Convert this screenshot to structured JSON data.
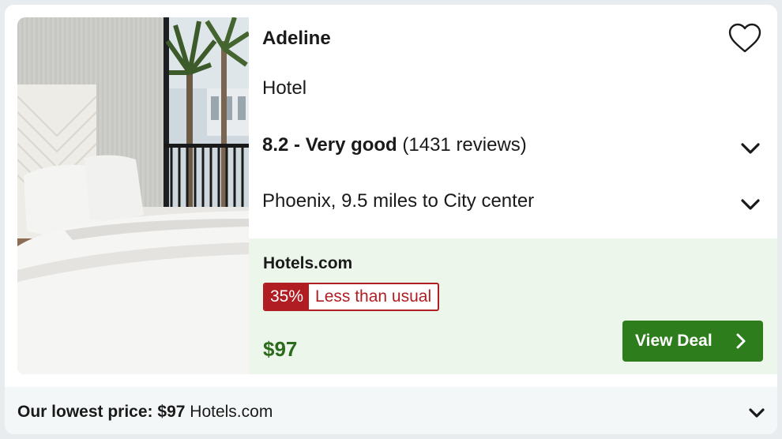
{
  "hotel": {
    "name": "Adeline",
    "type": "Hotel",
    "rating_score": "8.2 - Very good",
    "rating_reviews": "(1431 reviews)",
    "location": "Phoenix, 9.5 miles to City center"
  },
  "deal": {
    "provider": "Hotels.com",
    "discount_percent": "35%",
    "discount_text": "Less than usual",
    "price": "$97",
    "button_label": "View Deal"
  },
  "footer": {
    "label": "Our lowest price:",
    "price": "$97",
    "provider": "Hotels.com"
  },
  "icons": {
    "favorite": "heart-outline-icon",
    "expand": "chevron-down-icon",
    "next": "chevron-right-icon"
  },
  "colors": {
    "deal_background": "#edf6ea",
    "button": "#2e7d1c",
    "price": "#2b6b1b",
    "discount": "#b01e23"
  }
}
